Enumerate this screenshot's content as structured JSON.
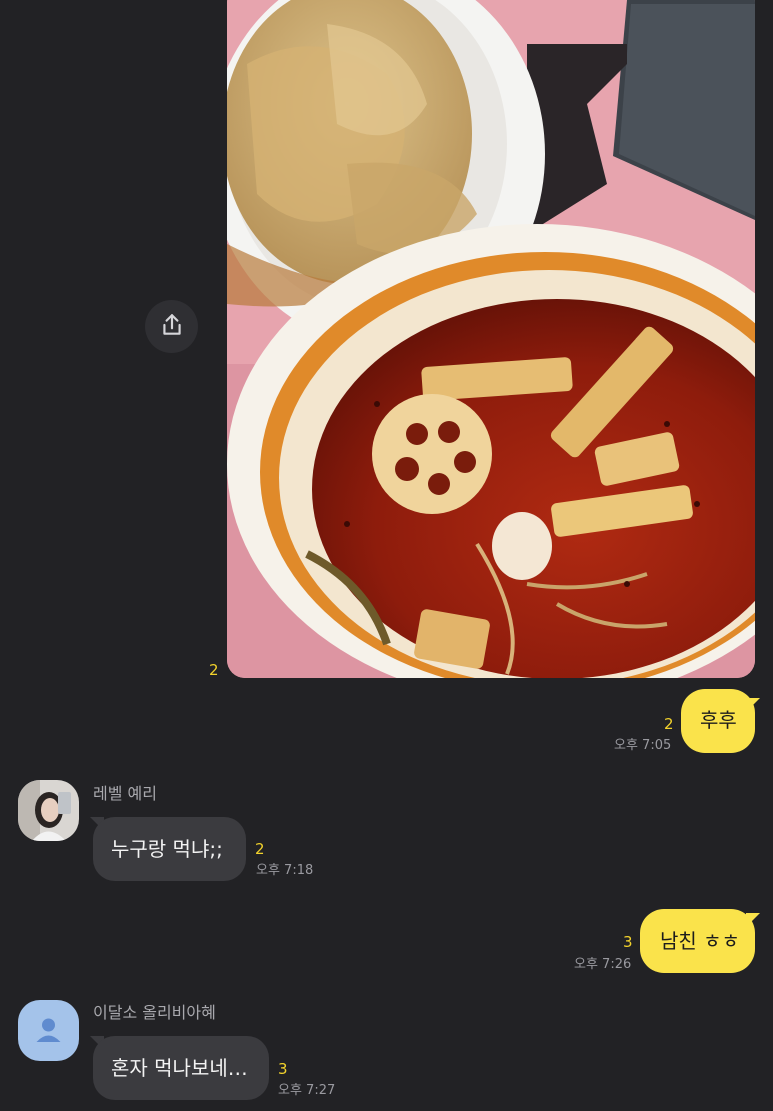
{
  "messages": {
    "photo": {
      "unread": "2"
    },
    "m1": {
      "text": "후후",
      "unread": "2",
      "time": "오후 7:05"
    },
    "m2": {
      "sender": "레벨 예리",
      "text": "누구랑 먹냐;;",
      "unread": "2",
      "time": "오후 7:18"
    },
    "m3": {
      "text": "남친 ㅎㅎ",
      "unread": "3",
      "time": "오후 7:26"
    },
    "m4": {
      "sender": "이달소 올리비아혜",
      "text": "혼자 먹나보네…",
      "unread": "3",
      "time": "오후 7:27"
    }
  },
  "colors": {
    "background": "#222225",
    "my_bubble": "#fae34b",
    "other_bubble": "#3b3b3f",
    "unread_count": "#f2d22c"
  },
  "icons": {
    "share": "share-icon",
    "default_avatar": "person-icon"
  }
}
